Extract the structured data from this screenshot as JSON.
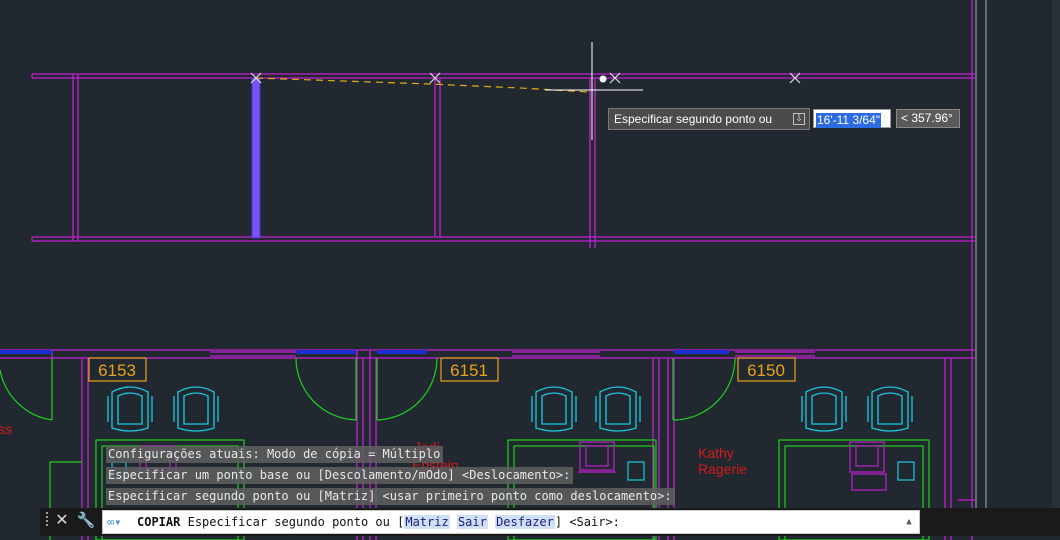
{
  "drawing": {
    "room_numbers": [
      "6153",
      "6151",
      "6150"
    ],
    "room_labels": [
      {
        "lines": [
          "ss"
        ]
      },
      {
        "lines": [
          "Jodi",
          "Epstein"
        ]
      },
      {
        "lines": [
          "Kathy",
          "Ragerie"
        ]
      }
    ],
    "colors": {
      "background": "#212830",
      "walls": "#c21fd1",
      "doors": "#1cd11c",
      "chairs": "#19c9e4",
      "room_tag": "#e8a413",
      "names": "#d21b1b",
      "blue_wall": "#1d2fd3",
      "selected_stud": "#7b52f5",
      "rubberband": "#d6a21a"
    }
  },
  "dynamic_input": {
    "prompt": "Especificar segundo ponto ou",
    "distance_value": "16'-11 3/64\"",
    "angle_value": "< 357.96°",
    "icon": "download-icon"
  },
  "command_history": [
    "Configurações atuais: Modo de cópia = Múltiplo",
    "Especificar um ponto base ou [Descolamento/mOdo] <Deslocamento>:",
    "Especificar segundo ponto ou [Matriz] <usar primeiro ponto como deslocamento>:"
  ],
  "command_line": {
    "command_name": "COPIAR",
    "prompt_text": "Especificar segundo ponto ou [",
    "options": [
      "Matriz",
      "Sair",
      "Desfazer"
    ],
    "suffix": "] <Sair>:",
    "icons": {
      "close": "close-icon",
      "customize": "wrench-icon",
      "recent": "recent-commands-icon",
      "scroll": "chevron-up-icon"
    }
  }
}
